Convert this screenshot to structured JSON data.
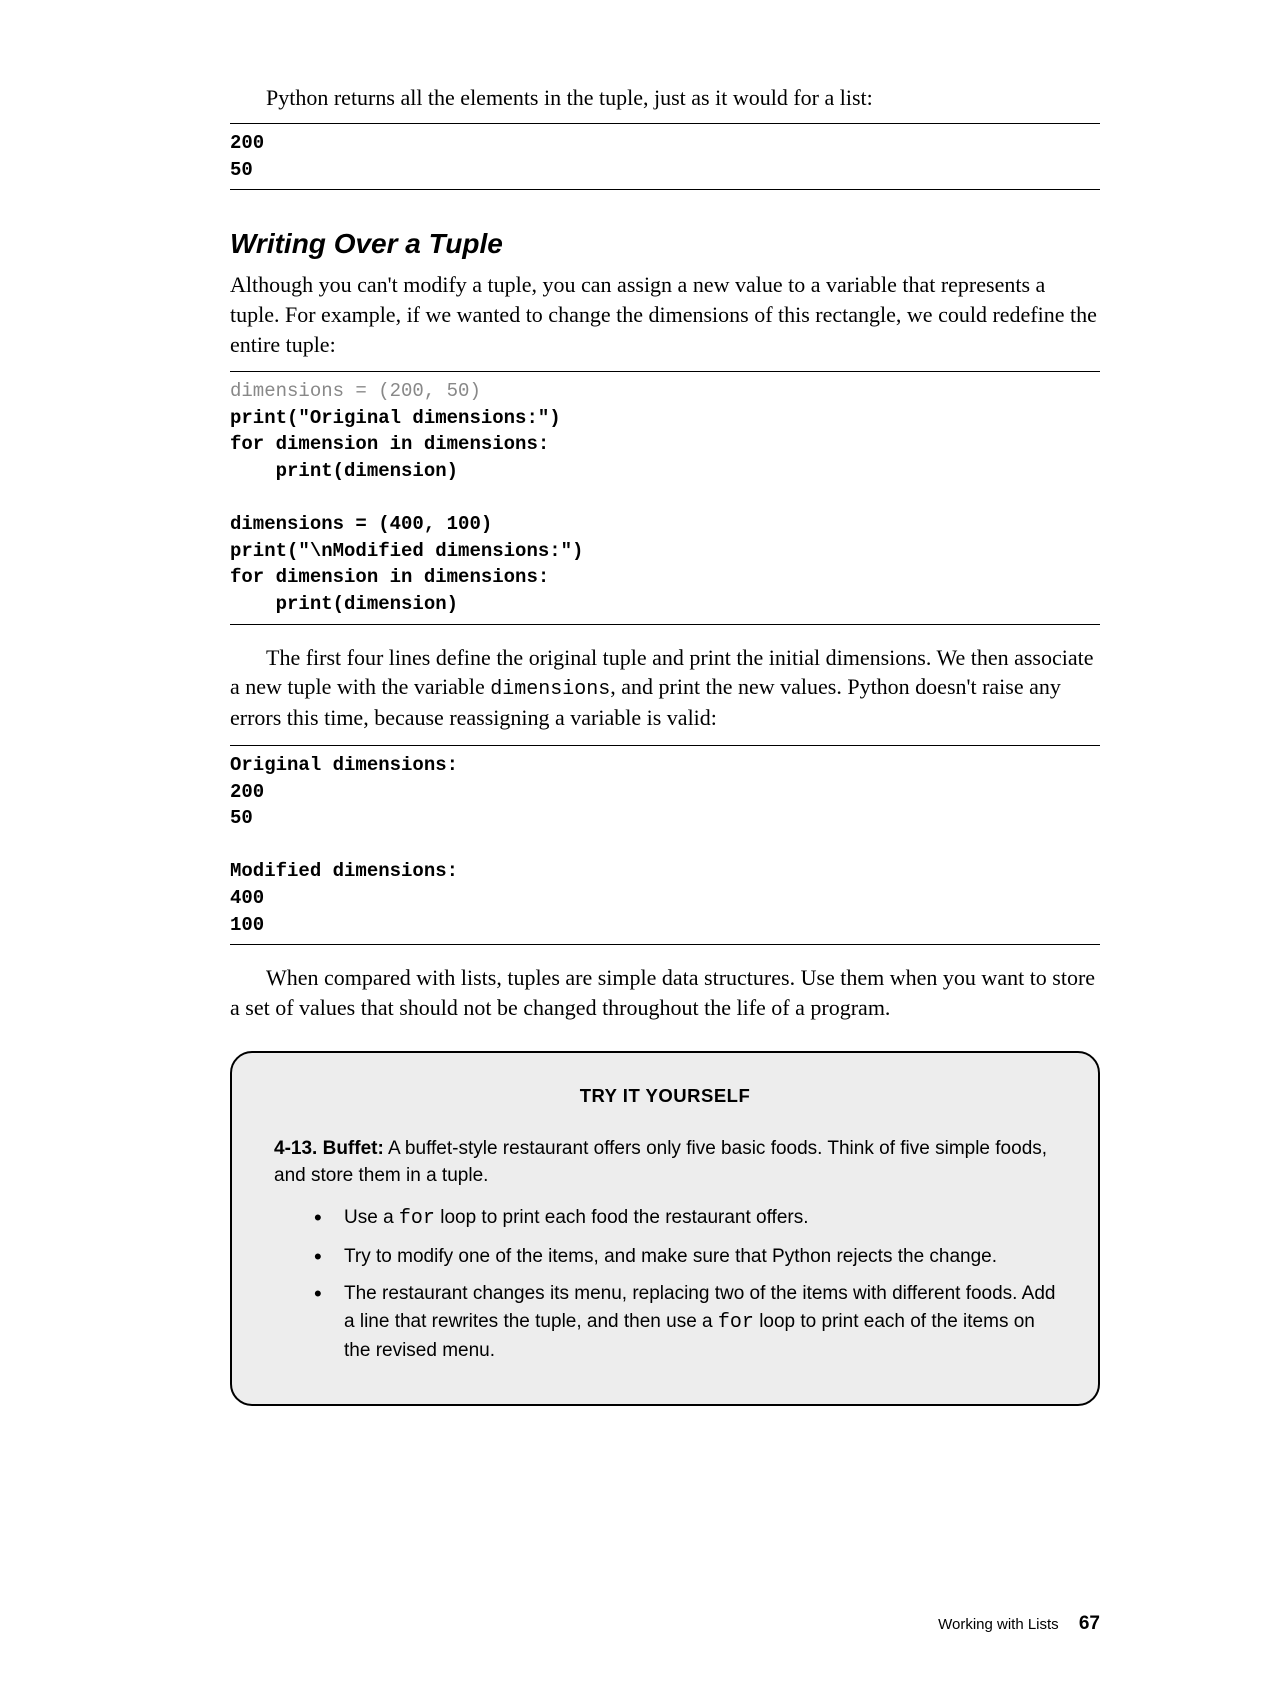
{
  "intro": "Python returns all the elements in the tuple, just as it would for a list:",
  "code1": "200\n50",
  "section_title": "Writing Over a Tuple",
  "para1": "Although you can't modify a tuple, you can assign a new value to a variable that represents a tuple. For example, if we wanted to change the dimensions of this rectangle, we could redefine the entire tuple:",
  "code2_line1": "dimensions = (200, 50)",
  "code2_rest": "print(\"Original dimensions:\")\nfor dimension in dimensions:\n    print(dimension)\n\ndimensions = (400, 100)\nprint(\"\\nModified dimensions:\")\nfor dimension in dimensions:\n    print(dimension)",
  "para2a": "The first four lines define the original tuple and print the initial dimensions. We then associate a new tuple with the variable ",
  "para2_code": "dimensions",
  "para2b": ", and print the new values. Python doesn't raise any errors this time, because reassigning a variable is valid:",
  "code3": "Original dimensions:\n200\n50\n\nModified dimensions:\n400\n100",
  "para3": "When compared with lists, tuples are simple data structures. Use them when you want to store a set of values that should not be changed throughout the life of a program.",
  "try_title": "TRY IT YOURSELF",
  "exercise": {
    "num": "4-13.",
    "title": "Buffet:",
    "desc": " A buffet-style restaurant offers only five basic foods. Think of five simple foods, and store them in a tuple."
  },
  "bullets": {
    "b1a": "Use a ",
    "b1code": "for",
    "b1b": " loop to print each food the restaurant offers.",
    "b2": "Try to modify one of the items, and make sure that Python rejects the change.",
    "b3a": "The restaurant changes its menu, replacing two of the items with different foods. Add a line that rewrites the tuple, and then use a ",
    "b3code": "for",
    "b3b": " loop to print each of the items on the revised menu."
  },
  "footer_text": "Working with Lists",
  "page_num": "67"
}
